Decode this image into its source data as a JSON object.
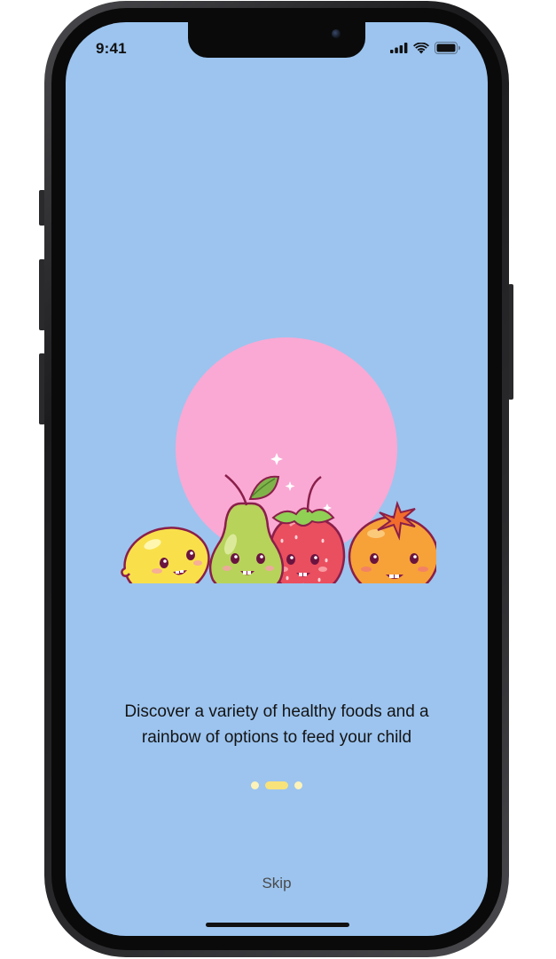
{
  "status_bar": {
    "time": "9:41",
    "icons": [
      "cellular-signal-icon",
      "wifi-icon",
      "battery-icon"
    ]
  },
  "onboarding": {
    "illustration": "fruit-characters-illustration",
    "description_line1": "Discover a variety of healthy foods and a",
    "description_line2": "rainbow of options to feed your child",
    "page_indicator": {
      "total_pages": 3,
      "current_page": 2
    },
    "skip_label": "Skip"
  },
  "colors": {
    "screen_background": "#9cc4ef",
    "pink_circle": "#f9a9d4",
    "indicator_active": "#f8e27a",
    "indicator_inactive": "#fdf3b8"
  }
}
